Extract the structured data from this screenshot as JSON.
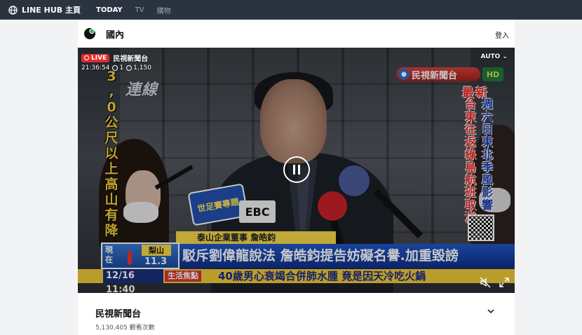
{
  "topbar": {
    "brand": "LINE HUB 主頁",
    "nav": [
      "TODAY",
      "TV",
      "購物"
    ]
  },
  "section": {
    "title": "國內",
    "login": "登入"
  },
  "player": {
    "live_label": "LIVE",
    "channel": "民視新聞台",
    "time": "21:36:54",
    "likes": "1",
    "viewers": "1,150",
    "quality": "AUTO",
    "state": "playing"
  },
  "broadcast": {
    "left_vertical": "3,0 公尺以上高山有降",
    "left_tag": "連線",
    "station_logo": "民視新聞台",
    "hd": "HD",
    "latest": "最新",
    "right_col1": "週六日東北季風影響",
    "right_col2": "台東往返綠島航班取消",
    "badge": "世足賽專題",
    "ebc": "EBC",
    "nameplate": "泰山企業董事 詹皓鈞",
    "headline": "駁斥劉偉龍說法 詹皓鈞提告妨礙名譽.加重毀謗",
    "weather_loc": "現在",
    "weather_city": "梨山",
    "weather_temp": "11.3",
    "ticker_time": "12/16 11:40",
    "ticker_tag": "生活焦點",
    "ticker_text": "40歲男心衰竭合併肺水腫 竟是因天冷吃火鍋"
  },
  "info": {
    "channel_name": "民視新聞台",
    "views": "5,130,405 觀看次數"
  },
  "colors": {
    "topbar": "#2b3340",
    "live": "#e02b2b",
    "headline_bar": "#1a44b0",
    "ticker": "#f0c93a"
  }
}
